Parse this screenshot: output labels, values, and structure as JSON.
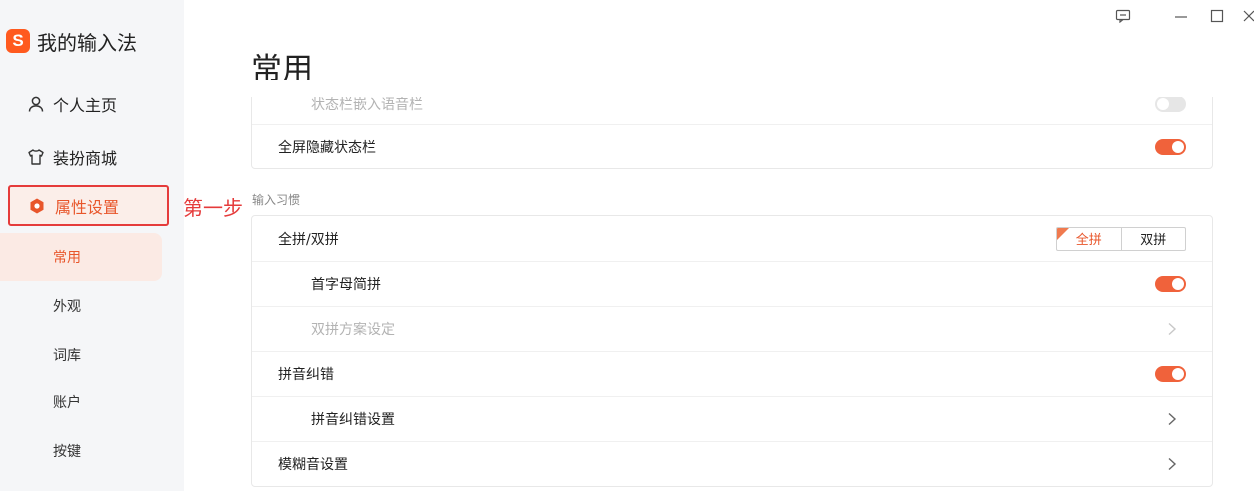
{
  "app": {
    "title": "我的输入法"
  },
  "sidebar": {
    "nav": [
      {
        "label": "个人主页",
        "icon": "user-icon"
      },
      {
        "label": "装扮商城",
        "icon": "shirt-icon"
      },
      {
        "label": "属性设置",
        "icon": "settings-hexagon-icon",
        "selected": true
      }
    ],
    "sub_items": [
      {
        "label": "常用",
        "selected": true
      },
      {
        "label": "外观"
      },
      {
        "label": "词库"
      },
      {
        "label": "账户"
      },
      {
        "label": "按键"
      }
    ]
  },
  "annotation": {
    "step_label": "第一步"
  },
  "window_controls": {
    "icons": [
      "feedback-icon",
      "minimize-icon",
      "maximize-icon",
      "close-icon"
    ]
  },
  "page": {
    "title": "常用",
    "card1": {
      "rows": [
        {
          "label": "状态栏嵌入语音栏",
          "toggle": false,
          "disabled": true
        },
        {
          "label": "全屏隐藏状态栏",
          "toggle": true
        }
      ]
    },
    "section_input_habit": "输入习惯",
    "card2": {
      "rows": [
        {
          "label": "全拼/双拼",
          "segment": {
            "options": [
              "全拼",
              "双拼"
            ],
            "selected": "全拼"
          }
        },
        {
          "label": "首字母简拼",
          "toggle": true
        },
        {
          "label": "双拼方案设定",
          "disabled": true
        },
        {
          "label": "拼音纠错",
          "toggle": true
        },
        {
          "label": "拼音纠错设置"
        },
        {
          "label": "模糊音设置"
        }
      ]
    }
  },
  "colors": {
    "accent": "#f0623b",
    "highlight_box": "#e53b3b",
    "sidebar_bg": "#f5f6f8"
  }
}
